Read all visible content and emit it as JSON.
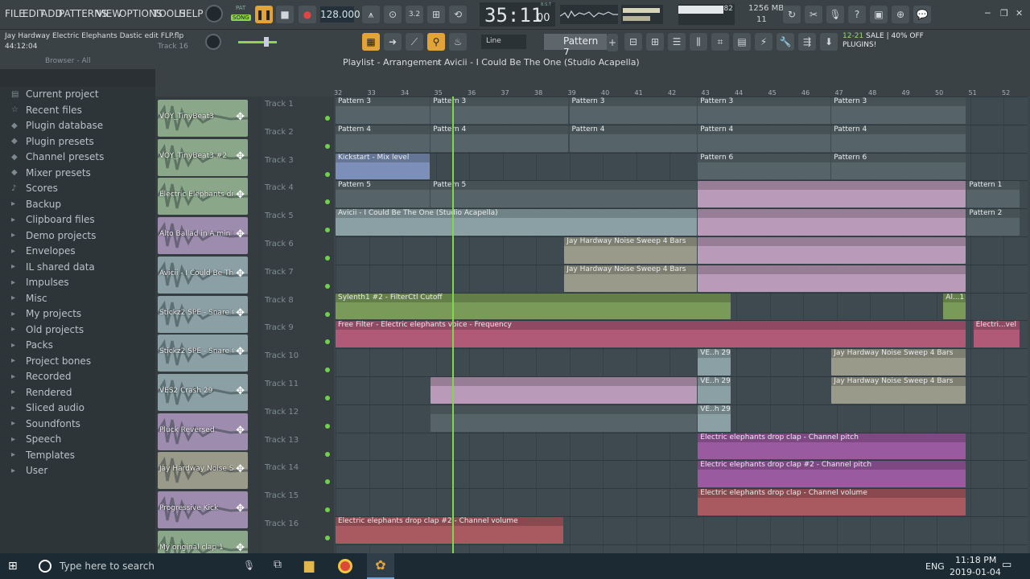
{
  "menu": [
    "FILE",
    "EDIT",
    "ADD",
    "PATTERNS",
    "VIEW",
    "OPTIONS",
    "TOOLS",
    "HELP"
  ],
  "transport": {
    "mode": "SONG",
    "pat_label": "PAT",
    "tempo": "128.000",
    "time": "35:11",
    "time_sub": "00",
    "bst": "B:S:T"
  },
  "project": {
    "title": "Jay Hardway Electric Elephants Dastic edit FLP.flp",
    "time": "44:12:04",
    "track": "Track 16"
  },
  "cpu": {
    "mem": "1256 MB",
    "voices": "11",
    "cpu": "82"
  },
  "toolbar2": {
    "snap": "Line",
    "pattern": "Pattern 7",
    "news_date": "12-21",
    "news_title": "SALE | 40% OFF",
    "news_sub": "PLUGINS!"
  },
  "browser": {
    "header": "Browser - All",
    "items": [
      "Current project",
      "Recent files",
      "Plugin database",
      "Plugin presets",
      "Channel presets",
      "Mixer presets",
      "Scores",
      "Backup",
      "Clipboard files",
      "Demo projects",
      "Envelopes",
      "IL shared data",
      "Impulses",
      "Misc",
      "My projects",
      "Old projects",
      "Packs",
      "Project bones",
      "Recorded",
      "Rendered",
      "Sliced audio",
      "Soundfonts",
      "Speech",
      "Templates",
      "User"
    ]
  },
  "channels": [
    {
      "name": "VOY_TinyBeat3",
      "color": "#8aa889"
    },
    {
      "name": "VOY_TinyBeat3 #2",
      "color": "#8aa889"
    },
    {
      "name": "Electric Elephants dro...",
      "color": "#8aa889"
    },
    {
      "name": "Alto Ballad in A min 01",
      "color": "#9d8cae"
    },
    {
      "name": "Avicii - I Could Be The...",
      "color": "#8aa0a5"
    },
    {
      "name": "Stickz2 SPE - Snare 0...",
      "color": "#8aa0a5"
    },
    {
      "name": "Stickz2 SPE - Snare 0...",
      "color": "#8aa0a5"
    },
    {
      "name": "VES2 Crash 29",
      "color": "#8aa0a5"
    },
    {
      "name": "Pluck Reversed",
      "color": "#9d8cae"
    },
    {
      "name": "Jay Hardway Noise S...",
      "color": "#9a9a8a"
    },
    {
      "name": "Progressive Kick",
      "color": "#9d8cae"
    },
    {
      "name": "My original clap 1",
      "color": "#8aa889"
    }
  ],
  "playlist": {
    "title": "Playlist - Arrangement",
    "crumb": "Avicii - I Could Be The One (Studio Acapella)",
    "bars": [
      "32",
      "33",
      "34",
      "35",
      "36",
      "37",
      "38",
      "39",
      "40",
      "41",
      "42",
      "43",
      "44",
      "45",
      "46",
      "47",
      "48",
      "49",
      "50",
      "51",
      "52"
    ],
    "tracks": [
      "Track 1",
      "Track 2",
      "Track 3",
      "Track 4",
      "Track 5",
      "Track 6",
      "Track 7",
      "Track 8",
      "Track 9",
      "Track 10",
      "Track 11",
      "Track 12",
      "Track 13",
      "Track 14",
      "Track 15",
      "Track 16"
    ],
    "clips": [
      {
        "row": 0,
        "from": 0,
        "to": 2.85,
        "label": "Pattern 3",
        "color": "#56646a"
      },
      {
        "row": 0,
        "from": 2.85,
        "to": 7,
        "label": "Pattern 3",
        "color": "#56646a"
      },
      {
        "row": 0,
        "from": 7,
        "to": 10.85,
        "label": "Pattern 3",
        "color": "#56646a"
      },
      {
        "row": 0,
        "from": 10.85,
        "to": 14.85,
        "label": "Pattern 3",
        "color": "#56646a"
      },
      {
        "row": 0,
        "from": 14.85,
        "to": 18.9,
        "label": "Pattern 3",
        "color": "#56646a"
      },
      {
        "row": 1,
        "from": 0,
        "to": 2.85,
        "label": "Pattern 4",
        "color": "#56646a"
      },
      {
        "row": 1,
        "from": 2.85,
        "to": 7,
        "label": "Pattern 4",
        "color": "#56646a"
      },
      {
        "row": 1,
        "from": 7,
        "to": 10.85,
        "label": "Pattern 4",
        "color": "#56646a"
      },
      {
        "row": 1,
        "from": 10.85,
        "to": 14.85,
        "label": "Pattern 4",
        "color": "#56646a"
      },
      {
        "row": 1,
        "from": 14.85,
        "to": 18.9,
        "label": "Pattern 4",
        "color": "#56646a"
      },
      {
        "row": 2,
        "from": 0,
        "to": 2.85,
        "label": "Kickstart - Mix level",
        "color": "#7c8fb8"
      },
      {
        "row": 2,
        "from": 10.85,
        "to": 14.85,
        "label": "Pattern 6",
        "color": "#56646a"
      },
      {
        "row": 2,
        "from": 14.85,
        "to": 18.9,
        "label": "Pattern 6",
        "color": "#56646a"
      },
      {
        "row": 3,
        "from": 0,
        "to": 2.85,
        "label": "Pattern 5",
        "color": "#56646a"
      },
      {
        "row": 3,
        "from": 2.85,
        "to": 10.85,
        "label": "Pattern 5",
        "color": "#56646a"
      },
      {
        "row": 3,
        "from": 10.85,
        "to": 18.9,
        "label": "",
        "color": "#b99ab8"
      },
      {
        "row": 3,
        "from": 18.9,
        "to": 20.5,
        "label": "Pattern 1",
        "color": "#56646a"
      },
      {
        "row": 4,
        "from": 0,
        "to": 10.85,
        "label": "Avicii - I Could Be The One (Studio Acapella)",
        "color": "#8aa0a5"
      },
      {
        "row": 4,
        "from": 10.85,
        "to": 18.9,
        "label": "",
        "color": "#b99ab8"
      },
      {
        "row": 4,
        "from": 18.9,
        "to": 20.5,
        "label": "Pattern 2",
        "color": "#56646a"
      },
      {
        "row": 5,
        "from": 6.85,
        "to": 10.85,
        "label": "Jay Hardway Noise Sweep 4 Bars",
        "color": "#9a9a8a"
      },
      {
        "row": 5,
        "from": 10.85,
        "to": 18.9,
        "label": "",
        "color": "#b99ab8"
      },
      {
        "row": 6,
        "from": 6.85,
        "to": 10.85,
        "label": "Jay Hardway Noise Sweep 4 Bars",
        "color": "#9a9a8a"
      },
      {
        "row": 6,
        "from": 10.85,
        "to": 18.9,
        "label": "",
        "color": "#b99ab8"
      },
      {
        "row": 7,
        "from": 0,
        "to": 11.85,
        "label": "Sylenth1 #2 - FilterCtl Cutoff",
        "color": "#7a9a5a"
      },
      {
        "row": 7,
        "from": 18.2,
        "to": 18.9,
        "label": "Al...1",
        "color": "#7a9a5a"
      },
      {
        "row": 8,
        "from": 0,
        "to": 18.9,
        "label": "Free Filter - Electric elephants voice - Frequency",
        "color": "#b05a78"
      },
      {
        "row": 8,
        "from": 19.1,
        "to": 20.5,
        "label": "Electri...vel",
        "color": "#b05a78"
      },
      {
        "row": 9,
        "from": 10.85,
        "to": 11.85,
        "label": "VE..h 29",
        "color": "#8aa0a5"
      },
      {
        "row": 9,
        "from": 14.85,
        "to": 18.9,
        "label": "Jay Hardway Noise Sweep 4 Bars",
        "color": "#9a9a8a"
      },
      {
        "row": 10,
        "from": 2.85,
        "to": 10.85,
        "label": "",
        "color": "#b99ab8"
      },
      {
        "row": 10,
        "from": 10.85,
        "to": 11.85,
        "label": "VE..h 29",
        "color": "#8aa0a5"
      },
      {
        "row": 10,
        "from": 14.85,
        "to": 18.9,
        "label": "Jay Hardway Noise Sweep 4 Bars",
        "color": "#9a9a8a"
      },
      {
        "row": 11,
        "from": 2.85,
        "to": 10.85,
        "label": "",
        "color": "#56646a"
      },
      {
        "row": 11,
        "from": 10.85,
        "to": 11.85,
        "label": "VE..h 29",
        "color": "#8aa0a5"
      },
      {
        "row": 12,
        "from": 10.85,
        "to": 18.9,
        "label": "Electric elephants drop clap - Channel pitch",
        "color": "#9a5aa0"
      },
      {
        "row": 13,
        "from": 10.85,
        "to": 18.9,
        "label": "Electric elephants drop clap #2 - Channel pitch",
        "color": "#9a5aa0"
      },
      {
        "row": 14,
        "from": 10.85,
        "to": 18.9,
        "label": "Electric elephants drop clap - Channel volume",
        "color": "#a85a60"
      },
      {
        "row": 15,
        "from": 0,
        "to": 6.85,
        "label": "Electric elephants drop clap #2 - Channel volume",
        "color": "#a85a60"
      }
    ],
    "playhead_bar": 35.5
  },
  "taskbar": {
    "search": "Type here to search",
    "time": "11:18 PM",
    "date": "2019-01-04",
    "lang": "ENG"
  }
}
